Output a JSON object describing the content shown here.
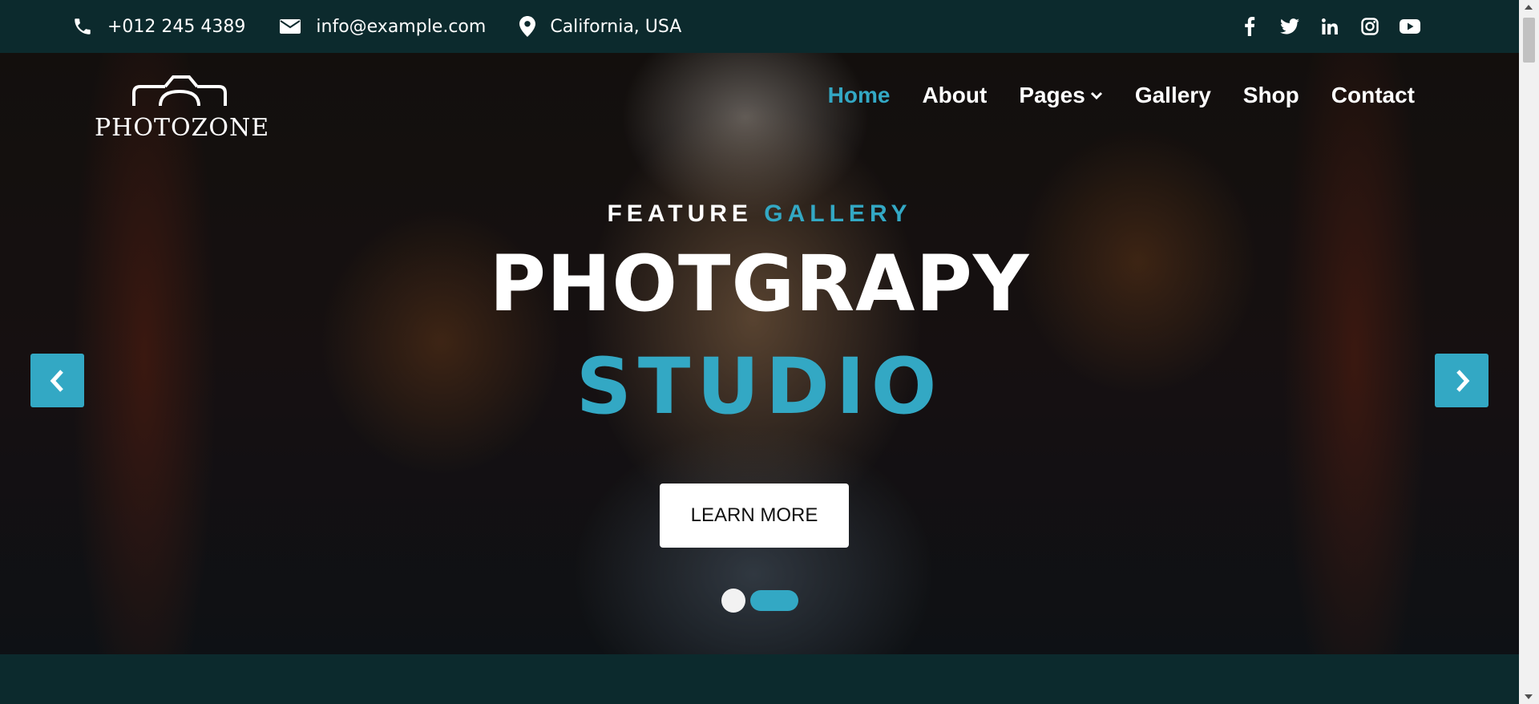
{
  "topbar": {
    "phone": "+012 245 4389",
    "email": "info@example.com",
    "location": "California, USA",
    "social": [
      "facebook-icon",
      "twitter-icon",
      "linkedin-icon",
      "instagram-icon",
      "youtube-icon"
    ]
  },
  "brand": {
    "logo_text": "PHOTOZONE"
  },
  "nav": {
    "items": [
      {
        "label": "Home",
        "active": true
      },
      {
        "label": "About"
      },
      {
        "label": "Pages",
        "dropdown": true
      },
      {
        "label": "Gallery"
      },
      {
        "label": "Shop"
      },
      {
        "label": "Contact"
      }
    ]
  },
  "hero": {
    "subtitle_part1": "FEATURE",
    "subtitle_part2": "GALLERY",
    "title_line1": "PHOTGRAPY",
    "title_line2": "STUDIO",
    "cta_label": "LEARN MORE",
    "slides_count": 2,
    "active_slide": 2
  },
  "colors": {
    "accent": "#33a8c4",
    "dark_bg": "#0c2a2d",
    "text": "#ffffff"
  }
}
